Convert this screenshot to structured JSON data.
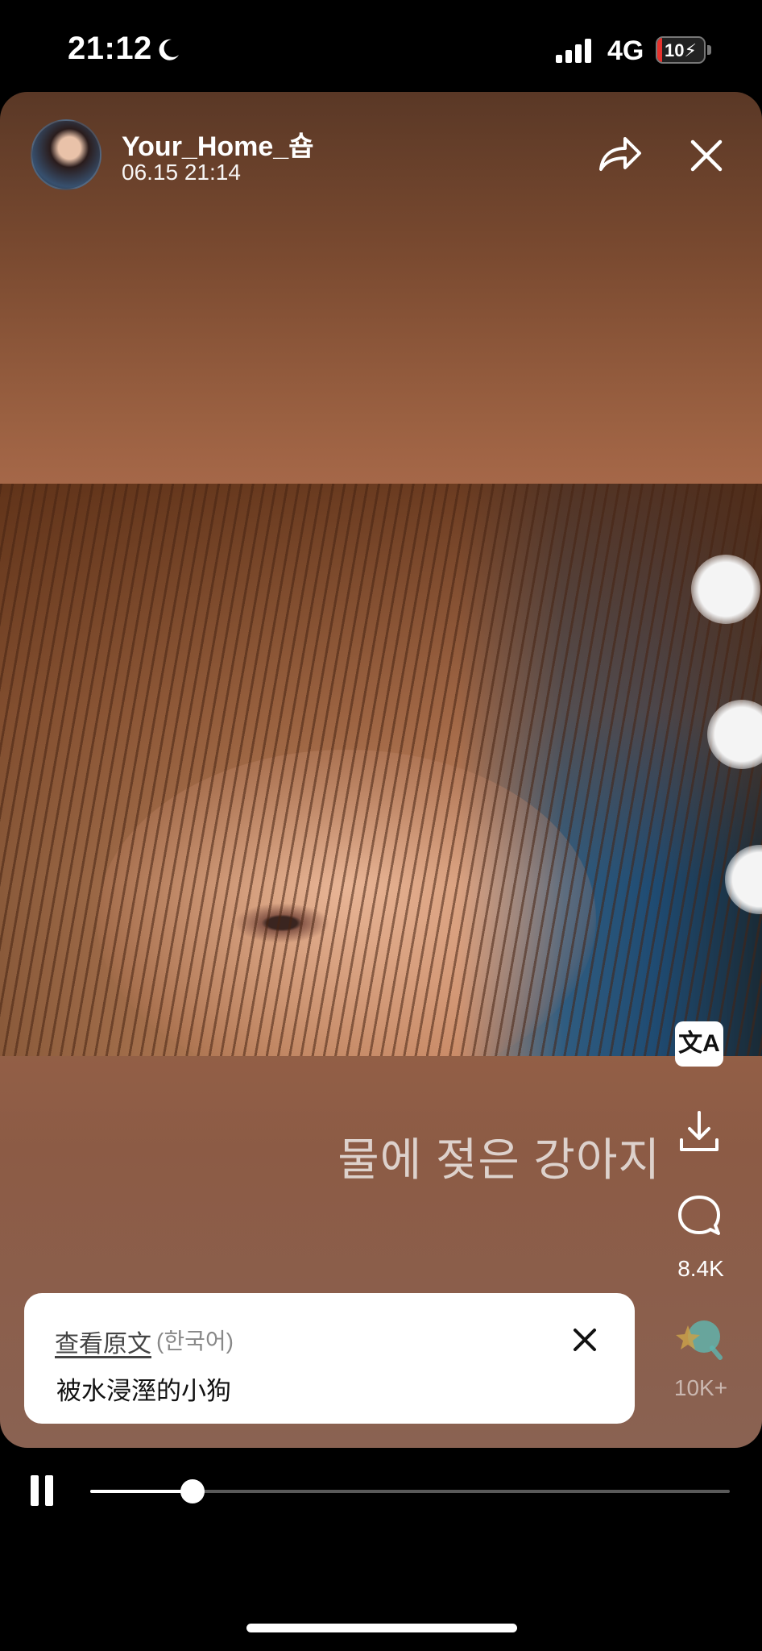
{
  "status_bar": {
    "time": "21:12",
    "network": "4G",
    "battery_label": "10",
    "battery_level": 0.1,
    "icons": [
      "moon-icon",
      "signal-bars-icon",
      "charging-bolt-icon"
    ]
  },
  "post": {
    "username": "Your_Home_숍",
    "datetime": "06.15 21:14",
    "caption_korean": "물에 젖은 강아지"
  },
  "actions": {
    "translate_label": "文A",
    "comment_count": "8.4K",
    "reaction_count": "10K+"
  },
  "translation": {
    "view_original": "查看原文",
    "original_language": "(한국어)",
    "translated_text": "被水浸溼的小狗"
  },
  "player": {
    "progress": 0.16,
    "state": "playing"
  },
  "colors": {
    "accent_white": "#ffffff",
    "battery_low": "#e5322d",
    "background": "#000000"
  }
}
